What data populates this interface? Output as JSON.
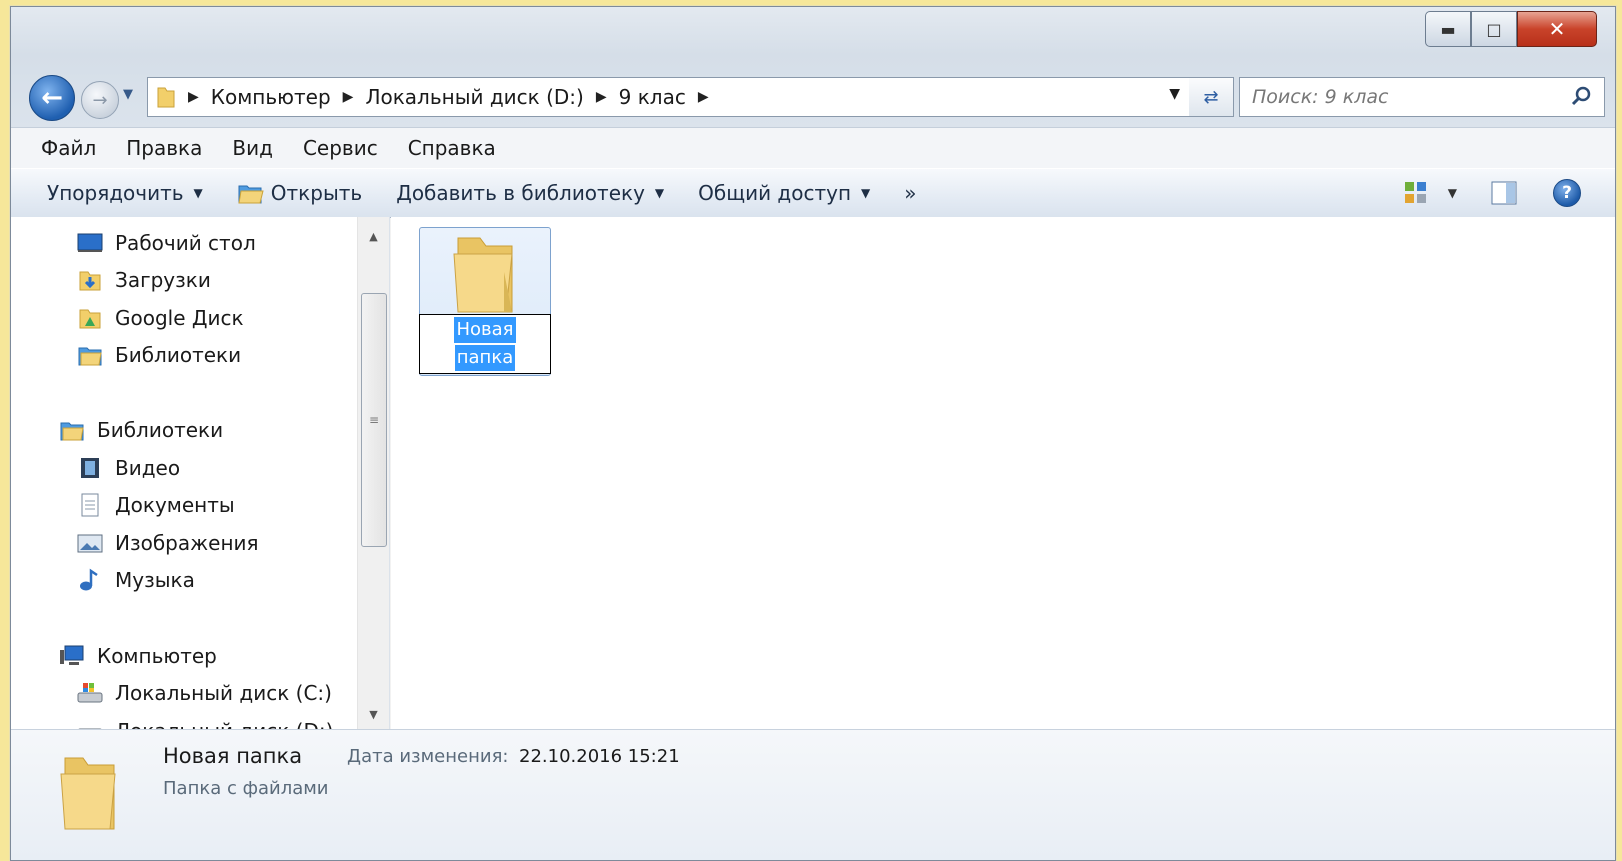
{
  "window": {
    "colors": {
      "accent": "#1f5fb0",
      "selection": "#3399ff",
      "close": "#c9432a"
    }
  },
  "address": {
    "crumbs": [
      "Компьютер",
      "Локальный диск (D:)",
      "9 клас"
    ]
  },
  "search": {
    "placeholder": "Поиск: 9 клас"
  },
  "menu": [
    "Файл",
    "Правка",
    "Вид",
    "Сервис",
    "Справка"
  ],
  "toolbar": {
    "organize": "Упорядочить",
    "open": "Открыть",
    "add_to_library": "Добавить в библиотеку",
    "share": "Общий доступ",
    "more": "»"
  },
  "nav": {
    "favorites": [
      {
        "label": "Рабочий стол",
        "icon": "desktop-icon"
      },
      {
        "label": "Загрузки",
        "icon": "downloads-icon"
      },
      {
        "label": "Google Диск",
        "icon": "google-drive-icon"
      },
      {
        "label": "Библиотеки",
        "icon": "libraries-icon"
      }
    ],
    "libraries_header": "Библиотеки",
    "libraries": [
      {
        "label": "Видео",
        "icon": "video-icon"
      },
      {
        "label": "Документы",
        "icon": "documents-icon"
      },
      {
        "label": "Изображения",
        "icon": "pictures-icon"
      },
      {
        "label": "Музыка",
        "icon": "music-icon"
      }
    ],
    "computer_header": "Компьютер",
    "drives": [
      {
        "label": "Локальный диск (C:)",
        "icon": "drive-c-icon"
      },
      {
        "label": "Локальный диск (D:)",
        "icon": "drive-d-icon"
      }
    ]
  },
  "content": {
    "items": [
      {
        "name_line1": "Новая",
        "name_line2": "папка",
        "icon": "folder-icon",
        "state": "renaming"
      }
    ]
  },
  "details": {
    "name": "Новая папка",
    "type": "Папка с файлами",
    "modified_label": "Дата изменения:",
    "modified_value": "22.10.2016 15:21"
  }
}
